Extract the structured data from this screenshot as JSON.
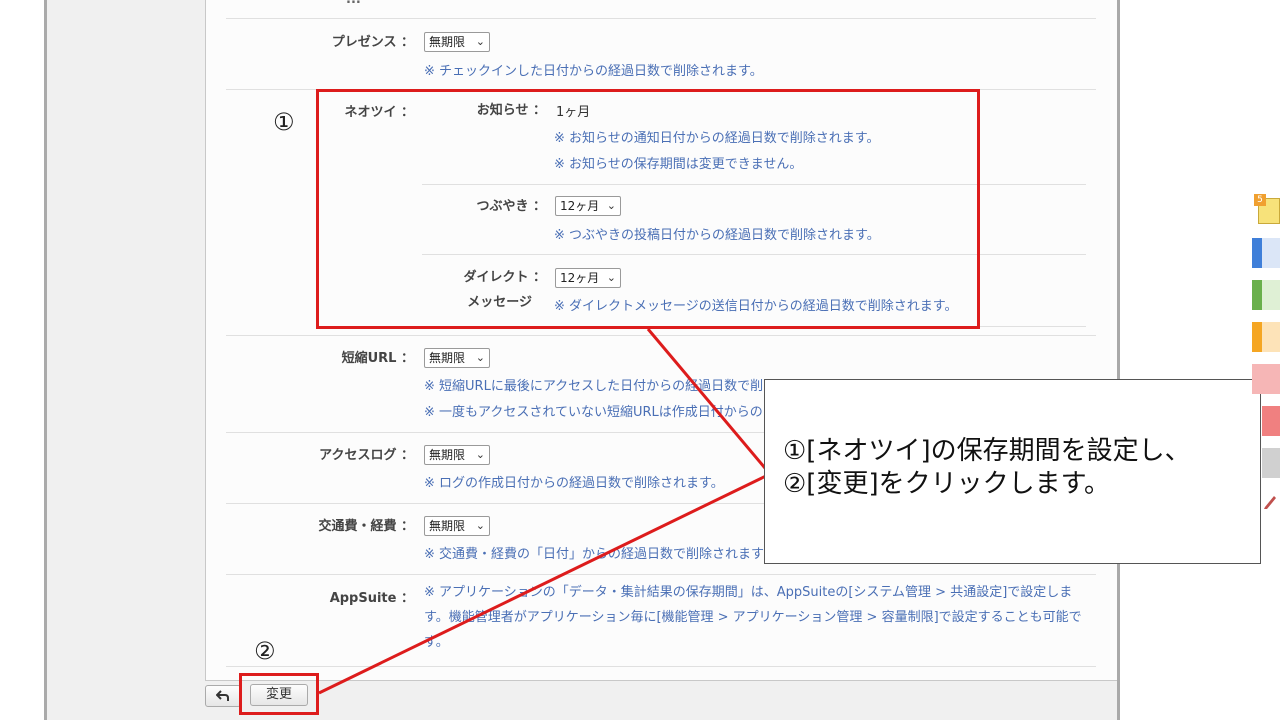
{
  "top_partial": "...",
  "rows": {
    "presence": {
      "label": "プレゼンス ：",
      "select": "無期限",
      "note": "※ チェックインした日付からの経過日数で削除されます。"
    },
    "neotwi": {
      "label": "ネオツイ ：",
      "notice": {
        "label": "お知らせ ：",
        "value": "1ヶ月",
        "note1": "※ お知らせの通知日付からの経過日数で削除されます。",
        "note2": "※ お知らせの保存期間は変更できません。"
      },
      "tweet": {
        "label": "つぶやき ：",
        "select": "12ヶ月",
        "note": "※ つぶやきの投稿日付からの経過日数で削除されます。"
      },
      "dm": {
        "label1": "ダイレクト ：",
        "label2": "メッセージ",
        "select": "12ヶ月",
        "note": "※ ダイレクトメッセージの送信日付からの経過日数で削除されます。"
      }
    },
    "short_url": {
      "label": "短縮URL ：",
      "select": "無期限",
      "note1": "※ 短縮URLに最後にアクセスした日付からの経過日数で削",
      "note2": "※ 一度もアクセスされていない短縮URLは作成日付からの"
    },
    "access_log": {
      "label": "アクセスログ ：",
      "select": "無期限",
      "note": "※ ログの作成日付からの経過日数で削除されます。"
    },
    "expense": {
      "label": "交通費・経費 ：",
      "select": "無期限",
      "note": "※ 交通費・経費の「日付」からの経過日数で削除されます"
    },
    "appsuite": {
      "label": "AppSuite ：",
      "note": "※ アプリケーションの「データ・集計結果の保存期間」は、AppSuiteの[システム管理 > 共通設定]で設定します。機能管理者がアプリケーション毎に[機能管理 > アプリケーション管理 > 容量制限]で設定することも可能です。"
    }
  },
  "buttons": {
    "back_icon": "back-arrow-icon",
    "change": "変更"
  },
  "annotations": {
    "marker1": "①",
    "marker2": "②",
    "callout_line1": "①[ネオツイ]の保存期間を設定し、",
    "callout_line2": "②[変更]をクリックします。"
  },
  "sidebar_icons": [
    {
      "name": "memo-badge-icon",
      "badge": "5",
      "color": "#f0a030"
    },
    {
      "name": "blue-tab-icon",
      "color": "#3f7fd9"
    },
    {
      "name": "green-tab-icon",
      "color": "#6ab04c"
    },
    {
      "name": "orange-tab-icon",
      "color": "#f5a623"
    },
    {
      "name": "pink-tab-icon",
      "color": "#f6b6b6"
    },
    {
      "name": "red-tab-icon",
      "color": "#f08080"
    },
    {
      "name": "gray-tab-icon",
      "color": "#d0d0d0"
    },
    {
      "name": "pencil-icon",
      "color": "#c0504d"
    }
  ],
  "colors": {
    "accent_red": "#dd1c1c",
    "note_blue": "#4a6fb5"
  }
}
